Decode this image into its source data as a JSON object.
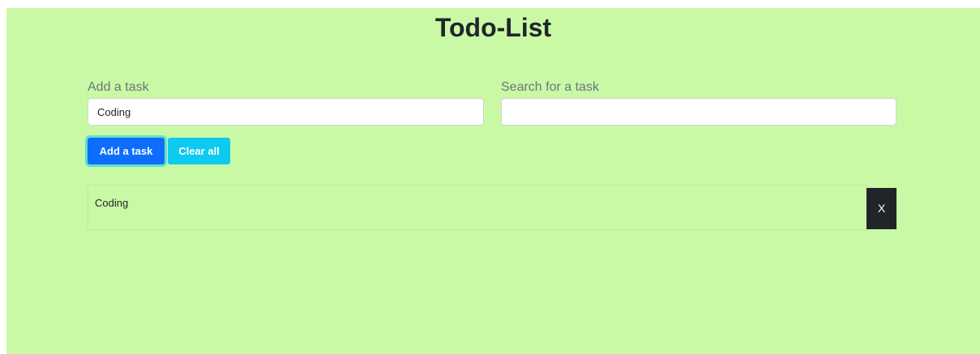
{
  "colors": {
    "background": "#c9f9a5",
    "primary": "#0d6efd",
    "info": "#0dcaf0",
    "dark": "#212529"
  },
  "header": {
    "title": "Todo-List"
  },
  "form": {
    "add_label": "Add a task",
    "add_value": "Coding",
    "add_placeholder": "",
    "search_label": "Search for a task",
    "search_value": "",
    "search_placeholder": ""
  },
  "buttons": {
    "add_label": "Add a task",
    "clear_label": "Clear all"
  },
  "tasks": [
    {
      "text": "Coding",
      "delete_label": "X"
    }
  ]
}
